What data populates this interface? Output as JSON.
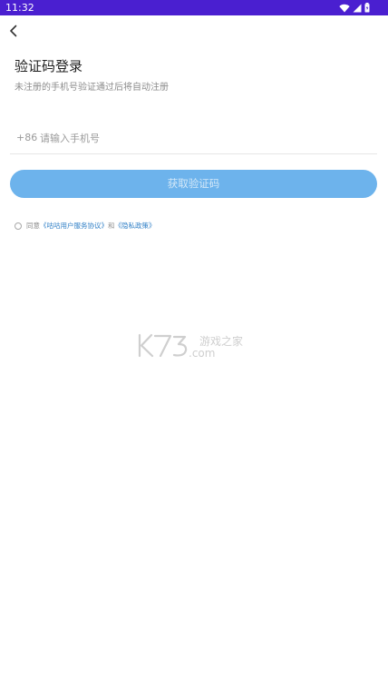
{
  "status_bar": {
    "time": "11:32",
    "icons": [
      "wifi-icon",
      "cellular-signal-icon",
      "battery-icon"
    ],
    "background": "#4a1fd0"
  },
  "header": {
    "back_icon": "chevron-left-icon"
  },
  "login": {
    "title": "验证码登录",
    "subtitle": "未注册的手机号验证通过后将自动注册",
    "country_code": "+86",
    "phone_placeholder": "请输入手机号",
    "phone_value": "",
    "get_code_label": "获取验证码",
    "button_color": "#6db3ec"
  },
  "agreement": {
    "checked": false,
    "prefix": "同意",
    "user_agreement_link": "《咕咕用户服务协议》",
    "conjunction": "和",
    "privacy_link": "《隐私政策》",
    "link_color": "#2f7fc6"
  },
  "watermark": {
    "logo_text": "K73",
    "site_text": "游戏之家",
    "domain_text": ".com"
  }
}
